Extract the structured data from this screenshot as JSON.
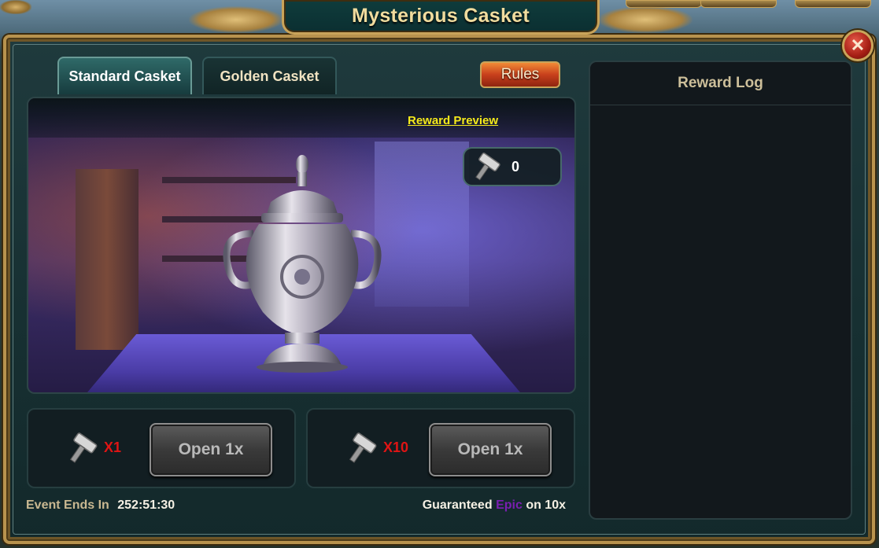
{
  "window": {
    "title": "Mysterious Casket",
    "close_icon": "close-x-icon"
  },
  "tabs": [
    {
      "label": "Standard Casket",
      "active": true
    },
    {
      "label": "Golden Casket",
      "active": false
    }
  ],
  "rules_label": "Rules",
  "preview": {
    "reward_preview_label": "Reward Preview",
    "hammer_count": "0",
    "icon": "hammer-icon",
    "image": "silver-casket-urn"
  },
  "open_options": [
    {
      "multiplier": "X1",
      "button_label": "Open 1x",
      "icon": "hammer-icon"
    },
    {
      "multiplier": "X10",
      "button_label": "Open 1x",
      "icon": "hammer-icon"
    }
  ],
  "footer": {
    "event_ends_label": "Event Ends In",
    "event_ends_time": "252:51:30",
    "guarantee_prefix": "Guaranteed",
    "guarantee_epic": "Epic",
    "guarantee_suffix": "on 10x"
  },
  "reward_log": {
    "title": "Reward Log"
  },
  "colors": {
    "frame_gold": "#b8934e",
    "epic_purple": "#7a1fb0",
    "multiplier_red": "#e01414",
    "link_yellow": "#f5ea1a"
  }
}
